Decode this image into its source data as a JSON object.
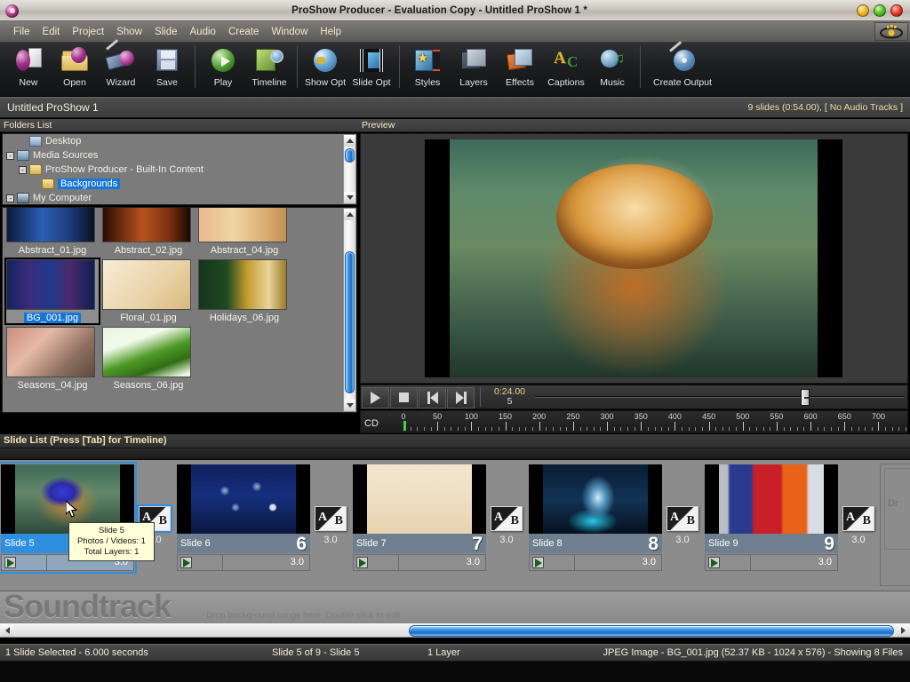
{
  "window": {
    "title": "ProShow Producer - Evaluation Copy - Untitled ProShow 1 *",
    "logo_icon": "proshow-logo-icon",
    "buttons": [
      {
        "name": "minimize",
        "label": ""
      },
      {
        "name": "maximize",
        "label": ""
      },
      {
        "name": "close",
        "label": ""
      }
    ]
  },
  "menubar": {
    "items": [
      "File",
      "Edit",
      "Project",
      "Show",
      "Slide",
      "Audio",
      "Create",
      "Window",
      "Help"
    ],
    "eye_icon": "eye-icon"
  },
  "toolbar": {
    "groups": [
      [
        {
          "label": "New",
          "icon": "new-show-icon"
        },
        {
          "label": "Open",
          "icon": "open-folder-icon"
        },
        {
          "label": "Wizard",
          "icon": "wizard-icon"
        },
        {
          "label": "Save",
          "icon": "save-disk-icon"
        }
      ],
      [
        {
          "label": "Play",
          "icon": "play-icon"
        },
        {
          "label": "Timeline",
          "icon": "timeline-icon"
        }
      ],
      [
        {
          "label": "Show Opt",
          "icon": "show-options-globe-icon"
        },
        {
          "label": "Slide Opt",
          "icon": "slide-options-film-icon"
        }
      ],
      [
        {
          "label": "Styles",
          "icon": "styles-icon"
        },
        {
          "label": "Layers",
          "icon": "layers-icon"
        },
        {
          "label": "Effects",
          "icon": "effects-icon"
        },
        {
          "label": "Captions",
          "icon": "captions-icon"
        },
        {
          "label": "Music",
          "icon": "music-icon"
        }
      ],
      [
        {
          "label": "Create Output",
          "icon": "create-output-cd-icon"
        }
      ]
    ]
  },
  "project": {
    "title": "Untitled ProShow 1",
    "meta": "9 slides (0:54.00), [ No Audio Tracks ]"
  },
  "folders_pane": {
    "header": "Folders List",
    "tree": [
      {
        "label": "Desktop",
        "indent": 1,
        "expander": "",
        "icon": "desktop-icon",
        "selected": false
      },
      {
        "label": "Media Sources",
        "indent": 0,
        "expander": "-",
        "icon": "media-sources-icon",
        "selected": false
      },
      {
        "label": "ProShow Producer - Built-In Content",
        "indent": 1,
        "expander": "-",
        "icon": "folder-icon",
        "selected": false
      },
      {
        "label": "Backgrounds",
        "indent": 2,
        "expander": "",
        "icon": "folder-icon",
        "selected": true
      },
      {
        "label": "My Computer",
        "indent": 0,
        "expander": "-",
        "icon": "my-computer-icon",
        "selected": false
      }
    ]
  },
  "file_browser": {
    "files": [
      {
        "name": "Abstract_01.jpg",
        "thumb": "th-abs1",
        "selected": false
      },
      {
        "name": "Abstract_02.jpg",
        "thumb": "th-abs2",
        "selected": false
      },
      {
        "name": "Abstract_04.jpg",
        "thumb": "th-abs4",
        "selected": false
      },
      {
        "name": "BG_001.jpg",
        "thumb": "th-bg1",
        "selected": true
      },
      {
        "name": "Floral_01.jpg",
        "thumb": "th-floral",
        "selected": false
      },
      {
        "name": "Holidays_06.jpg",
        "thumb": "th-holi",
        "selected": false
      },
      {
        "name": "Seasons_04.jpg",
        "thumb": "th-sea4",
        "selected": false
      },
      {
        "name": "Seasons_06.jpg",
        "thumb": "th-sea6",
        "selected": false
      }
    ]
  },
  "preview_pane": {
    "header": "Preview",
    "image_alt": "tiger-preview"
  },
  "playback": {
    "buttons": [
      {
        "name": "play-button",
        "icon": "play-icon"
      },
      {
        "name": "stop-button",
        "icon": "stop-icon"
      },
      {
        "name": "previous-button",
        "icon": "skip-previous-icon"
      },
      {
        "name": "next-button",
        "icon": "skip-next-icon"
      }
    ],
    "time": "0:24.00",
    "time_sub": "5"
  },
  "ruler": {
    "label": "CD",
    "ticks": [
      0,
      50,
      100,
      150,
      200,
      250,
      300,
      350,
      400,
      450,
      500,
      550,
      600,
      650,
      700
    ],
    "playhead": 0
  },
  "slide_list": {
    "header": "Slide List (Press [Tab] for Timeline)",
    "slides": [
      {
        "name": "Slide 5",
        "number": "5",
        "duration": "3.0",
        "transition_duration": "3.0",
        "selected": true,
        "thumb": "tiger"
      },
      {
        "name": "Slide 6",
        "number": "6",
        "duration": "3.0",
        "transition_duration": "3.0",
        "selected": false,
        "thumb": "flowers"
      },
      {
        "name": "Slide 7",
        "number": "7",
        "duration": "3.0",
        "transition_duration": "3.0",
        "selected": false,
        "thumb": "eiffel"
      },
      {
        "name": "Slide 8",
        "number": "8",
        "duration": "3.0",
        "transition_duration": "3.0",
        "selected": false,
        "thumb": "scifi"
      },
      {
        "name": "Slide 9",
        "number": "9",
        "duration": "3.0",
        "transition_duration": "3.0",
        "selected": false,
        "thumb": "team"
      }
    ],
    "dropzone_text": "Dr",
    "transition_icon": "ab-transition-icon"
  },
  "tooltip": {
    "line1": "Slide 5",
    "line2": "Photos / Videos: 1",
    "line3": "Total Layers: 1"
  },
  "soundtrack": {
    "title": "Soundtrack",
    "hint": "Drop background songs here.  Double click to edit."
  },
  "statusbar": {
    "selection": "1 Slide Selected - 6.000 seconds",
    "position": "Slide 5 of 9 - Slide 5",
    "layers": "1 Layer",
    "file_info": "JPEG Image - BG_001.jpg (52.37 KB - 1024 x 576) - Showing 8 Files"
  },
  "colors": {
    "accent_blue": "#2e8fe0",
    "selection_blue": "#1576d8",
    "menu_text": "#f2e9c8",
    "tooltip_bg": "#ffffd8"
  }
}
